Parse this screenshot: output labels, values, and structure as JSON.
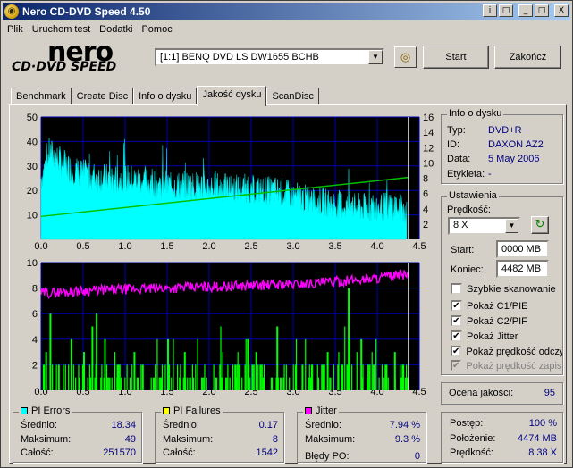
{
  "window": {
    "title": "Nero CD-DVD Speed 4.50"
  },
  "titlebar_buttons": [
    "i",
    "□",
    "_",
    "□",
    "X"
  ],
  "menu": [
    "Plik",
    "Uruchom test",
    "Dodatki",
    "Pomoc"
  ],
  "logo": {
    "brand": "nero",
    "product": "CD·DVD SPEED"
  },
  "drive": {
    "selected": "[1:1]  BENQ DVD LS DW1655 BCHB"
  },
  "buttons": {
    "start": "Start",
    "end": "Zakończ"
  },
  "tabs": [
    "Benchmark",
    "Create Disc",
    "Info o dysku",
    "Jakość dysku",
    "ScanDisc"
  ],
  "active_tab": "Jakość dysku",
  "disc_info": {
    "title": "Info o dysku",
    "type_label": "Typ:",
    "type": "DVD+R",
    "id_label": "ID:",
    "id": "DAXON AZ2",
    "date_label": "Data:",
    "date": "5 May 2006",
    "labels_label": "Etykieta:",
    "labels": "-"
  },
  "settings": {
    "title": "Ustawienia",
    "speed_label": "Prędkość:",
    "speed": "8 X",
    "start_label": "Start:",
    "start": "0000 MB",
    "end_label": "Koniec:",
    "end": "4482 MB",
    "checks": [
      {
        "label": "Szybkie skanowanie",
        "checked": false,
        "disabled": false
      },
      {
        "label": "Pokaż C1/PIE",
        "checked": true,
        "disabled": false
      },
      {
        "label": "Pokaż C2/PIF",
        "checked": true,
        "disabled": false
      },
      {
        "label": "Pokaż Jitter",
        "checked": true,
        "disabled": false
      },
      {
        "label": "Pokaż prędkość odczy",
        "checked": true,
        "disabled": false
      },
      {
        "label": "Pokaż prędkość zapisu",
        "checked": true,
        "disabled": true
      }
    ]
  },
  "quality": {
    "label": "Ocena jakości:",
    "value": "95"
  },
  "pi_errors": {
    "title": "PI Errors",
    "color": "#00ffff",
    "avg_label": "Średnio:",
    "avg": "18.34",
    "max_label": "Maksimum:",
    "max": "49",
    "total_label": "Całość:",
    "total": "251570"
  },
  "pi_failures": {
    "title": "PI Failures",
    "color": "#ffff00",
    "avg_label": "Średnio:",
    "avg": "0.17",
    "max_label": "Maksimum:",
    "max": "8",
    "total_label": "Całość:",
    "total": "1542"
  },
  "jitter": {
    "title": "Jitter",
    "color": "#ff00ff",
    "avg_label": "Średnio:",
    "avg": "7.94 %",
    "max_label": "Maksimum:",
    "max": "9.3 %",
    "po_label": "Błędy PO:",
    "po": "0"
  },
  "progress": {
    "progress_label": "Postęp:",
    "progress": "100 %",
    "position_label": "Położenie:",
    "position": "4474 MB",
    "speed_label": "Prędkość:",
    "speed": "8.38 X"
  },
  "chart_data": [
    {
      "type": "area",
      "series": [
        {
          "name": "PI Errors",
          "x": [
            0.0,
            0.1,
            0.2,
            0.3,
            0.4,
            0.5,
            0.6,
            0.8,
            1.0,
            1.2,
            1.4,
            1.6,
            1.8,
            2.0,
            2.2,
            2.4,
            2.6,
            2.8,
            3.0,
            3.2,
            3.4,
            3.6,
            3.8,
            4.0,
            4.2,
            4.35
          ],
          "values": [
            25,
            36,
            33,
            30,
            28,
            27,
            26,
            25,
            25,
            24,
            23,
            22,
            22,
            22,
            21,
            21,
            20,
            20,
            18,
            16,
            15,
            14,
            13,
            13,
            14,
            12
          ]
        },
        {
          "name": "Read speed",
          "x": [
            0.0,
            4.37
          ],
          "values": [
            3.0,
            8.1
          ]
        }
      ],
      "xlim": [
        0,
        4.5
      ],
      "ylim": [
        0,
        50
      ],
      "y2lim": [
        0,
        16
      ],
      "xticks": [
        "0.0",
        "0.5",
        "1.0",
        "1.5",
        "2.0",
        "2.5",
        "3.0",
        "3.5",
        "4.0",
        "4.5"
      ],
      "yticks": [
        "10",
        "20",
        "30",
        "40",
        "50"
      ],
      "y2ticks": [
        "2",
        "4",
        "6",
        "8",
        "10",
        "12",
        "14",
        "16"
      ]
    },
    {
      "type": "bar",
      "series": [
        {
          "name": "PI Failures",
          "x": [
            0.05,
            0.1,
            0.2,
            0.35,
            0.5,
            0.6,
            0.65,
            0.75,
            0.9,
            1.1,
            1.2,
            1.5,
            1.7,
            2.3,
            2.45,
            2.55,
            2.8,
            3.1,
            3.4,
            3.65,
            3.8,
            4.1,
            4.2,
            4.3
          ],
          "values": [
            3,
            6,
            2,
            4,
            3,
            5,
            6,
            4,
            2,
            3,
            2,
            4,
            3,
            2,
            4,
            3,
            5,
            2,
            3,
            8,
            4,
            2,
            3,
            2
          ]
        },
        {
          "name": "Jitter",
          "x": [
            0.0,
            0.5,
            1.0,
            1.5,
            2.0,
            2.5,
            3.0,
            3.5,
            4.0,
            4.37
          ],
          "values": [
            7.6,
            7.8,
            7.9,
            8.0,
            8.1,
            8.2,
            8.3,
            8.5,
            8.8,
            9.1
          ]
        }
      ],
      "xlim": [
        0,
        4.5
      ],
      "ylim": [
        0,
        10
      ],
      "xticks": [
        "0.0",
        "0.5",
        "1.0",
        "1.5",
        "2.0",
        "2.5",
        "3.0",
        "3.5",
        "4.0",
        "4.5"
      ],
      "yticks": [
        "2",
        "4",
        "6",
        "8",
        "10"
      ]
    }
  ]
}
